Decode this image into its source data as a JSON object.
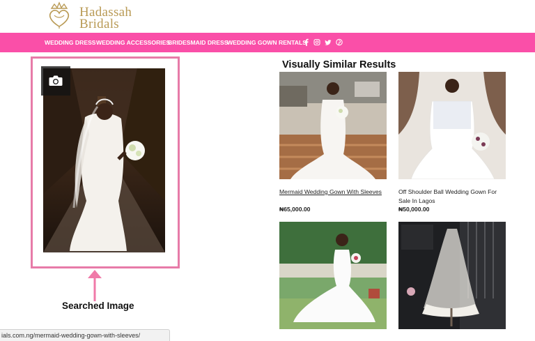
{
  "brand": {
    "line1": "Hadassah",
    "line2": "Bridals"
  },
  "nav": {
    "items": [
      "WEDDING DRESS",
      "WEDDING ACCESSORIES",
      "BRIDESMAID DRESS",
      "WEDDING GOWN RENTALS"
    ],
    "social_icons": [
      "facebook-icon",
      "instagram-icon",
      "twitter-icon",
      "pinterest-icon"
    ]
  },
  "search": {
    "caption": "Searched Image",
    "camera_icon": "camera-icon"
  },
  "results": {
    "title": "Visually Similar Results",
    "items": [
      {
        "title": "Mermaid Wedding Gown With Sleeves",
        "price": "₦65,000.00"
      },
      {
        "title": "Off Shoulder Ball Wedding Gown For Sale In Lagos",
        "price": "₦50,000.00"
      },
      {
        "title": "",
        "price": ""
      },
      {
        "title": "",
        "price": ""
      }
    ]
  },
  "status_bar": {
    "url": "ials.com.ng/mermaid-wedding-gown-with-sleeves/"
  },
  "colors": {
    "nav_pink": "#fa4fa8",
    "frame_pink": "#e77ba8",
    "brand_gold": "#b99a55"
  }
}
